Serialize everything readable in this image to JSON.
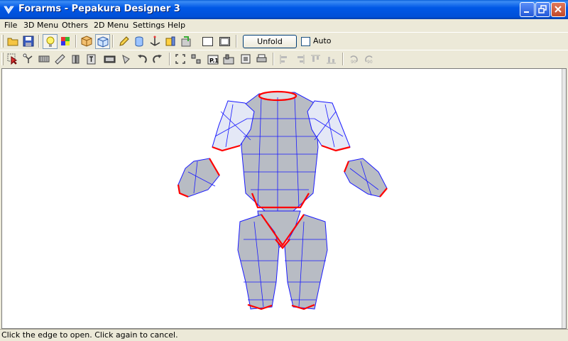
{
  "window": {
    "title": "Forarms - Pepakura Designer 3"
  },
  "menu": [
    "File",
    "3D Menu",
    "Others",
    "2D Menu",
    "Settings",
    "Help"
  ],
  "toolbar1": {
    "unfold_label": "Unfold",
    "auto_label": "Auto",
    "auto_checked": false
  },
  "status": {
    "text": "Click the edge to open. Click again to cancel."
  },
  "colors": {
    "titlebar": "#0058e6",
    "model_fill": "#b8bcc4",
    "mesh_edges": "#1a1aff",
    "open_edges": "#ff0000"
  }
}
